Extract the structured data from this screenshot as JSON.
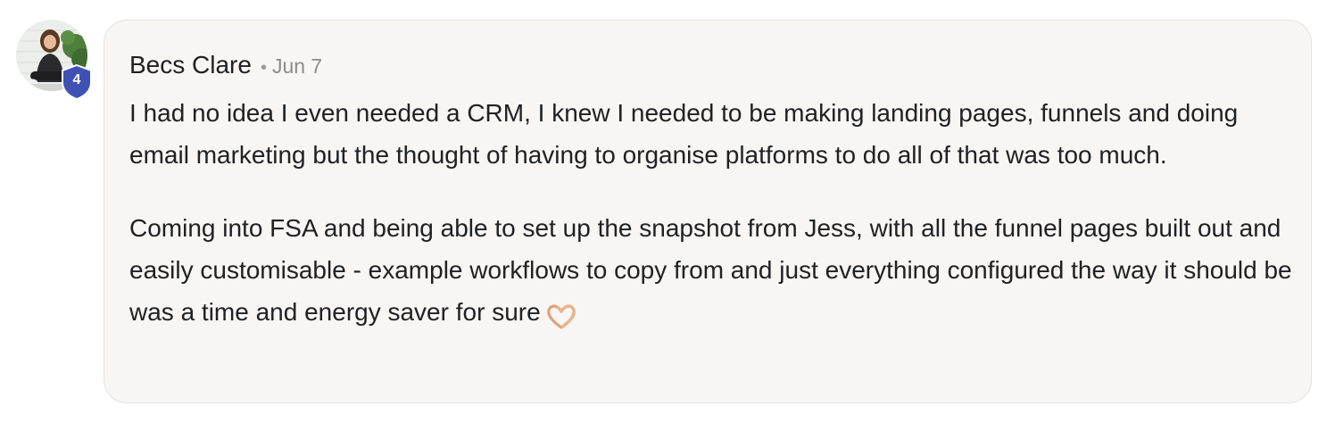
{
  "comment": {
    "author": "Becs Clare",
    "separator": "•",
    "date": "Jun 7",
    "level": "4",
    "paragraphs": [
      "I had no idea I even needed a CRM, I knew I needed to be making landing pages, funnels and doing email marketing but the thought of having to organise platforms to do all of that was too much.",
      "Coming into FSA and being able to set up the snapshot from Jess, with all the funnel pages built out and easily customisable - example workflows to copy from and just everything configured the way it should be was a time and energy saver for sure"
    ],
    "trailing_emoji": "heart-hands-emoji"
  },
  "colors": {
    "badge": "#3f51b5",
    "bubble_bg": "#f7f6f4",
    "text": "#202124",
    "muted": "#8c8c8c"
  }
}
